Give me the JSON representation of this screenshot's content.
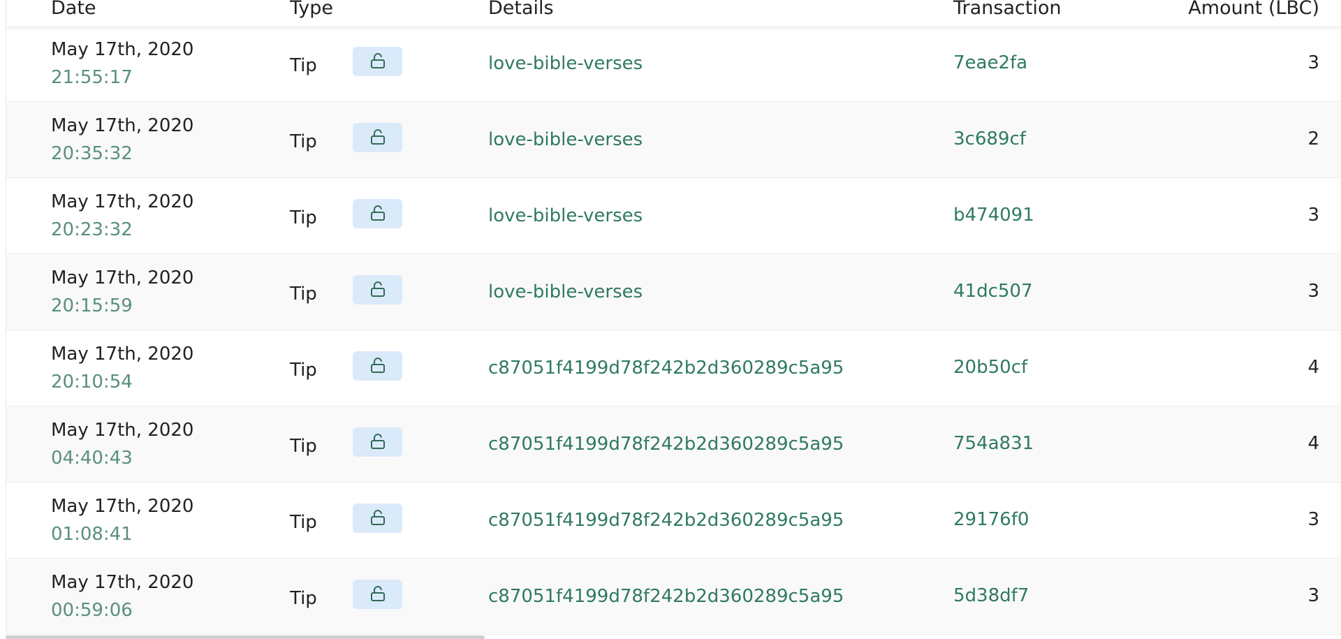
{
  "table": {
    "headers": {
      "date": "Date",
      "type": "Type",
      "details": "Details",
      "transaction": "Transaction",
      "amount": "Amount (LBC)"
    },
    "rows": [
      {
        "date": "May 17th, 2020",
        "time": "21:55:17",
        "type": "Tip",
        "details": "love-bible-verses",
        "transaction": "7eae2fa",
        "amount": "3"
      },
      {
        "date": "May 17th, 2020",
        "time": "20:35:32",
        "type": "Tip",
        "details": "love-bible-verses",
        "transaction": "3c689cf",
        "amount": "2"
      },
      {
        "date": "May 17th, 2020",
        "time": "20:23:32",
        "type": "Tip",
        "details": "love-bible-verses",
        "transaction": "b474091",
        "amount": "3"
      },
      {
        "date": "May 17th, 2020",
        "time": "20:15:59",
        "type": "Tip",
        "details": "love-bible-verses",
        "transaction": "41dc507",
        "amount": "3"
      },
      {
        "date": "May 17th, 2020",
        "time": "20:10:54",
        "type": "Tip",
        "details": "c87051f4199d78f242b2d360289c5a95",
        "transaction": "20b50cf",
        "amount": "4"
      },
      {
        "date": "May 17th, 2020",
        "time": "04:40:43",
        "type": "Tip",
        "details": "c87051f4199d78f242b2d360289c5a95",
        "transaction": "754a831",
        "amount": "4"
      },
      {
        "date": "May 17th, 2020",
        "time": "01:08:41",
        "type": "Tip",
        "details": "c87051f4199d78f242b2d360289c5a95",
        "transaction": "29176f0",
        "amount": "3"
      },
      {
        "date": "May 17th, 2020",
        "time": "00:59:06",
        "type": "Tip",
        "details": "c87051f4199d78f242b2d360289c5a95",
        "transaction": "5d38df7",
        "amount": "3"
      }
    ]
  },
  "icons": {
    "row_action": "unlock-icon"
  },
  "colors": {
    "link": "#2f7a5f",
    "time": "#5a8f7b",
    "lock_button_bg": "#dbeafa",
    "row_alt_bg": "#f9f9f9"
  }
}
